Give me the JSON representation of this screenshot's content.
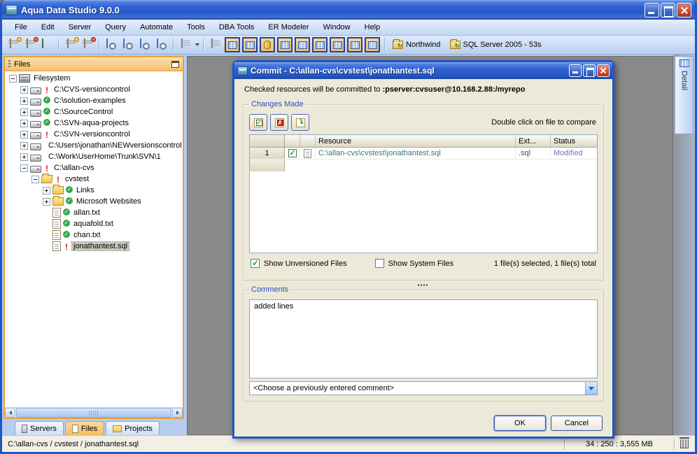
{
  "colors": {
    "accent_orange": "#F5BD62",
    "titlebar_blue": "#2A5AC6",
    "resource_teal": "#357878",
    "status_modified_blue": "#7070C8",
    "group_label_blue": "#2B4FC0",
    "workspace_gray": "#8A8A8A"
  },
  "window": {
    "title": "Aqua Data Studio 9.0.0"
  },
  "menu": {
    "items": [
      "File",
      "Edit",
      "Server",
      "Query",
      "Automate",
      "Tools",
      "DBA Tools",
      "ER Modeler",
      "Window",
      "Help"
    ]
  },
  "toolbar": {
    "connections": [
      {
        "label": "Northwind"
      },
      {
        "label": "SQL Server 2005 - 53s"
      }
    ]
  },
  "files_panel": {
    "title": "Files",
    "tree": [
      {
        "label": "Filesystem"
      },
      {
        "label": "C:\\CVS-versioncontrol"
      },
      {
        "label": "C:\\solution-examples"
      },
      {
        "label": "C:\\SourceControl"
      },
      {
        "label": "C:\\SVN-aqua-projects"
      },
      {
        "label": "C:\\SVN-versioncontrol"
      },
      {
        "label": "C:\\Users\\jonathan\\NEWversionscontrol"
      },
      {
        "label": "C:\\Work\\UserHome\\Trunk\\SVN\\1"
      },
      {
        "label": "C:\\allan-cvs"
      },
      {
        "label": "cvstest"
      },
      {
        "label": "Links"
      },
      {
        "label": "Microsoft Websites"
      },
      {
        "label": "allan.txt"
      },
      {
        "label": "aquafold.txt"
      },
      {
        "label": "chan.txt"
      },
      {
        "label": "jonathantest.sql"
      }
    ]
  },
  "bottom_tabs": [
    {
      "label": "Servers"
    },
    {
      "label": "Files",
      "active": true
    },
    {
      "label": "Projects"
    }
  ],
  "detail_tab": {
    "label": "Detail"
  },
  "statusbar": {
    "path": "C:\\allan-cvs / cvstest / jonathantest.sql",
    "metrics": "34 : 250 : 3,555 MB"
  },
  "dialog": {
    "title": "Commit - C:\\allan-cvs\\cvstest\\jonathantest.sql",
    "commit_note_prefix": "Checked resources will be committed to ",
    "commit_target": ":pserver:cvsuser@10.168.2.88:/myrepo",
    "changes_group": {
      "label": "Changes Made",
      "hint": "Double click on file to compare",
      "table": {
        "columns": {
          "resource": "Resource",
          "ext": "Ext...",
          "status": "Status"
        },
        "rows": [
          {
            "num": "1",
            "checked": true,
            "resource": "C:\\allan-cvs\\cvstest\\jonathantest.sql",
            "ext": ".sql",
            "status": "Modified"
          }
        ]
      },
      "show_unversioned_label": "Show Unversioned Files",
      "show_unversioned_checked": true,
      "show_system_label": "Show System Files",
      "show_system_checked": false,
      "selection_summary": "1 file(s) selected, 1 file(s) total"
    },
    "comments_group": {
      "label": "Comments",
      "comment_text": "added lines",
      "combo_value": "<Choose a previously entered comment>"
    },
    "ok_label": "OK",
    "cancel_label": "Cancel"
  }
}
